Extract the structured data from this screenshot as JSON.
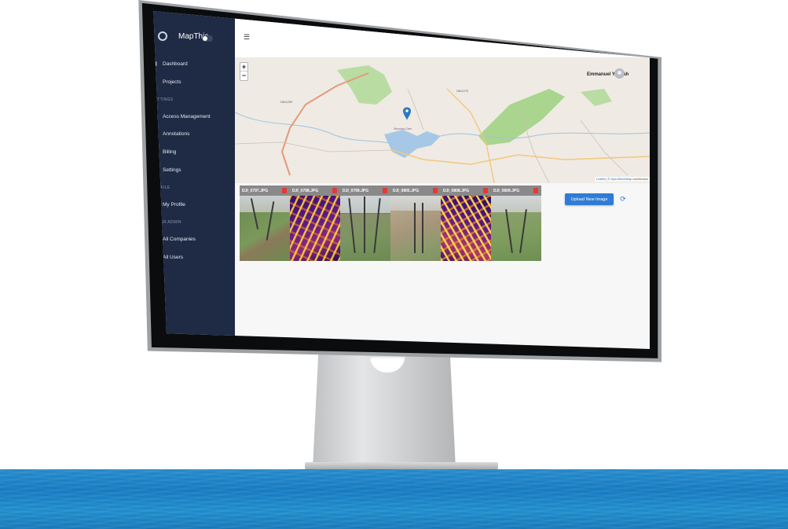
{
  "app": {
    "name": "MapThis"
  },
  "sidebar": {
    "items_main": [
      {
        "label": "Dashboard",
        "icon": "dashboard-icon"
      },
      {
        "label": "Projects",
        "icon": "tools-icon"
      }
    ],
    "section_settings": "SETTINGS",
    "items_settings": [
      {
        "label": "Access Management",
        "icon": "people-icon"
      },
      {
        "label": "Annotations",
        "icon": "annotation-icon"
      },
      {
        "label": "Billing",
        "icon": "dollar-icon"
      },
      {
        "label": "Settings",
        "icon": "gear-icon"
      }
    ],
    "section_profile": "PROFILE",
    "items_profile": [
      {
        "label": "My Profile",
        "icon": "person-icon"
      }
    ],
    "section_super_admin": "SUPER ADMIN",
    "items_admin": [
      {
        "label": "All Companies",
        "icon": "grid-icon"
      },
      {
        "label": "All Users",
        "icon": "grid-icon"
      }
    ]
  },
  "header": {
    "user_name": "Emmanuel Yeboah"
  },
  "map": {
    "zoom_in": "+",
    "zoom_out": "−",
    "attribution_leaflet": "Leaflet",
    "attribution_sep": " | © ",
    "attribution_osm": "OpenStreetMap",
    "attribution_tail": " contributors",
    "road_labels": [
      "N8/4255",
      "N8/4270"
    ],
    "place_label": "Nkawkaw Dam"
  },
  "actions": {
    "upload_label": "Upload New Image",
    "refresh_icon": "refresh-icon"
  },
  "images": [
    {
      "name": "DJI_0797.JPG",
      "kind": "photo"
    },
    {
      "name": "DJI_0798.JPG",
      "kind": "thermal"
    },
    {
      "name": "DJI_0799.JPG",
      "kind": "photo"
    },
    {
      "name": "DJI_0805.JPG",
      "kind": "photo"
    },
    {
      "name": "DJI_0808.JPG",
      "kind": "thermal"
    },
    {
      "name": "DJI_0809.JPG",
      "kind": "photo"
    }
  ],
  "colors": {
    "sidebar_bg": "#1f2a44",
    "accent": "#2f7bd6",
    "delete": "#e53935",
    "water": "#1a7fc4"
  }
}
